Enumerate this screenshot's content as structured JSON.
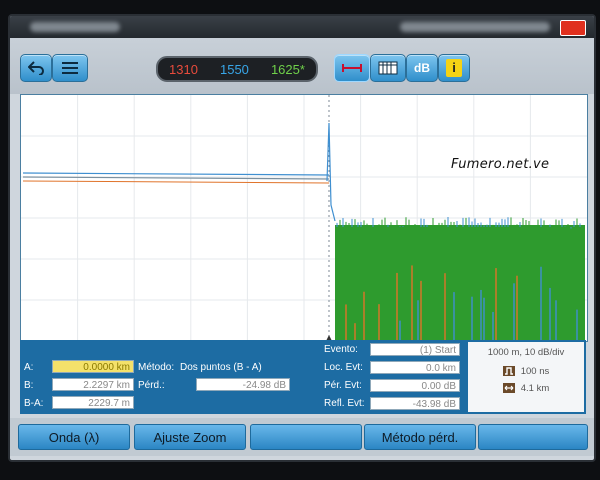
{
  "toolbar": {
    "wavelengths": [
      "1310",
      "1550",
      "1625*"
    ],
    "db_label": "dB",
    "info_label": "i"
  },
  "plot": {
    "watermark": "Fumero.net.ve"
  },
  "info": {
    "a_label": "A:",
    "a_value": "0.0000 km",
    "b_label": "B:",
    "b_value": "2.2297 km",
    "ba_label": "B-A:",
    "ba_value": "2229.7 m",
    "method_label": "Método:",
    "method_value": "Dos puntos (B - A)",
    "perd_label": "Pérd.:",
    "perd_value": "-24.98 dB",
    "evento_label": "Evento:",
    "evento_value": "(1) Start",
    "loc_label": "Loc. Evt:",
    "loc_value": "0.0 km",
    "per_label": "Pér. Evt:",
    "per_value": "0.00 dB",
    "refl_label": "Refl. Evt:",
    "refl_value": "-43.98 dB",
    "scale": "1000 m, 10 dB/div",
    "pulse": "100 ns",
    "range": "4.1 km"
  },
  "softkeys": {
    "onda": "Onda (λ)",
    "ajuste": "Ajuste Zoom",
    "blank": "",
    "metodo": "Método pérd.",
    "last": ""
  },
  "colors": {
    "accent_blue": "#1d6ca3",
    "trace_green": "#2e9b2e",
    "trace_blue": "#3f8fd0",
    "trace_orange": "#e0732a",
    "close_red": "#e0301e"
  }
}
